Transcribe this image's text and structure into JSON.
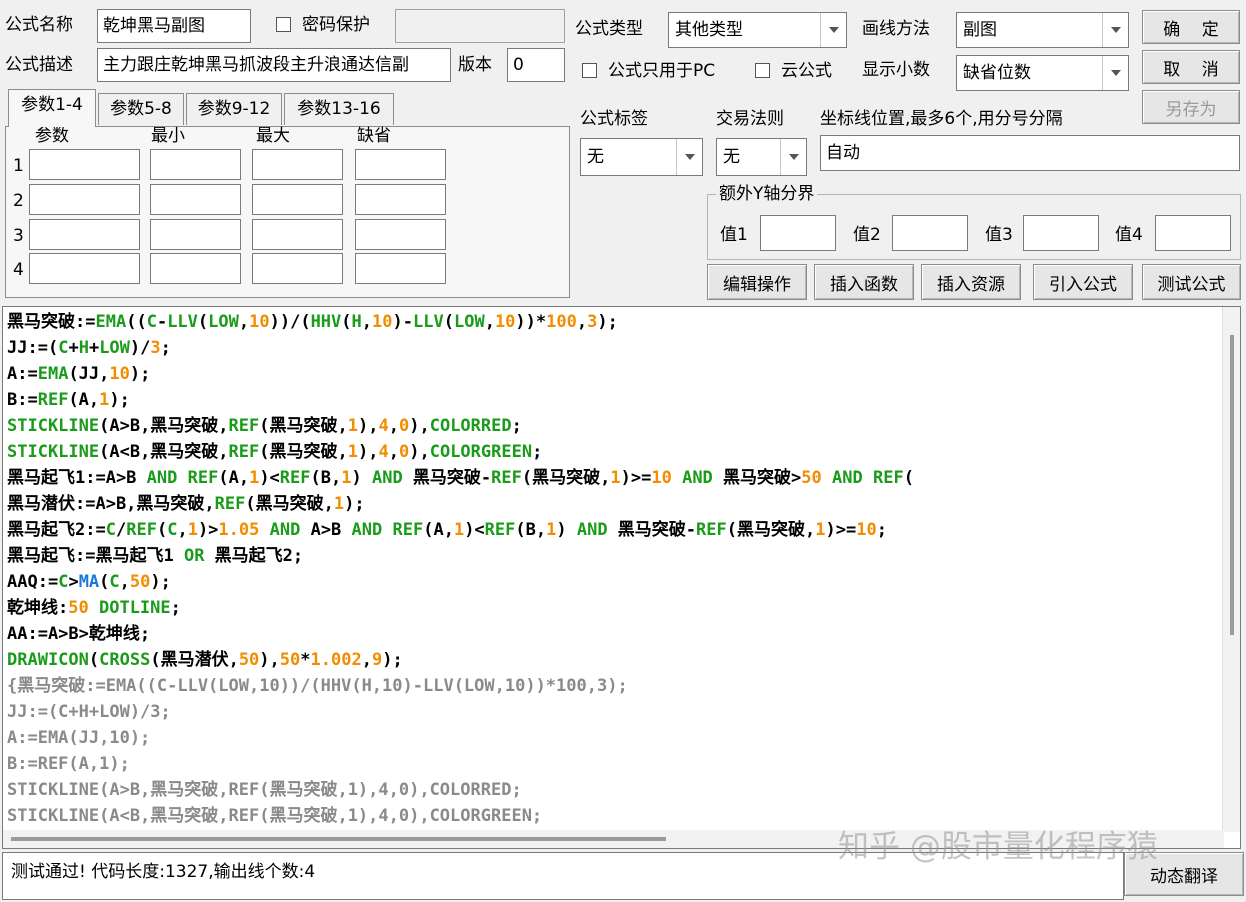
{
  "top": {
    "formula_name_label": "公式名称",
    "formula_name_value": "乾坤黑马副图",
    "password_label": "密码保护",
    "password_value": "",
    "formula_desc_label": "公式描述",
    "formula_desc_value": "主力跟庄乾坤黑马抓波段主升浪通达信副",
    "version_label": "版本",
    "version_value": "0",
    "formula_type_label": "公式类型",
    "formula_type_value": "其他类型",
    "draw_method_label": "画线方法",
    "draw_method_value": "副图",
    "pc_only_label": "公式只用于PC",
    "cloud_label": "云公式",
    "decimals_label": "显示小数",
    "decimals_value": "缺省位数"
  },
  "buttons": {
    "ok": "确 定",
    "cancel": "取 消",
    "save_as": "另存为",
    "edit_ops": "编辑操作",
    "insert_func": "插入函数",
    "insert_res": "插入资源",
    "import_formula": "引入公式",
    "test_formula": "测试公式",
    "dynamic_translate": "动态翻译"
  },
  "params": {
    "tabs": [
      "参数1-4",
      "参数5-8",
      "参数9-12",
      "参数13-16"
    ],
    "headers": [
      "参数",
      "最小",
      "最大",
      "缺省"
    ],
    "rows": [
      "1",
      "2",
      "3",
      "4"
    ]
  },
  "tag": {
    "label": "公式标签",
    "value": "无",
    "trade_label": "交易法则",
    "trade_value": "无",
    "axis_label": "坐标线位置,最多6个,用分号分隔",
    "axis_value": "自动"
  },
  "yaxis": {
    "group_label": "额外Y轴分界",
    "v1": "值1",
    "v2": "值2",
    "v3": "值3",
    "v4": "值4"
  },
  "code": [
    [
      [
        "",
        "黑马突破:="
      ],
      [
        "fn",
        "EMA"
      ],
      [
        "",
        "(("
      ],
      [
        "fn",
        "C"
      ],
      [
        "",
        "-"
      ],
      [
        "fn",
        "LLV"
      ],
      [
        "",
        "("
      ],
      [
        "fn",
        "LOW"
      ],
      [
        "",
        ","
      ],
      [
        "num",
        "10"
      ],
      [
        "",
        "))/("
      ],
      [
        "fn",
        "HHV"
      ],
      [
        "",
        "("
      ],
      [
        "fn",
        "H"
      ],
      [
        "",
        ","
      ],
      [
        "num",
        "10"
      ],
      [
        "",
        ")-"
      ],
      [
        "fn",
        "LLV"
      ],
      [
        "",
        "("
      ],
      [
        "fn",
        "LOW"
      ],
      [
        "",
        ","
      ],
      [
        "num",
        "10"
      ],
      [
        "",
        "))*"
      ],
      [
        "num",
        "100"
      ],
      [
        "",
        ","
      ],
      [
        "num",
        "3"
      ],
      [
        "",
        ");"
      ]
    ],
    [
      [
        "",
        "JJ:=("
      ],
      [
        "fn",
        "C"
      ],
      [
        "",
        "+"
      ],
      [
        "fn",
        "H"
      ],
      [
        "",
        "+"
      ],
      [
        "fn",
        "LOW"
      ],
      [
        "",
        ")/"
      ],
      [
        "num",
        "3"
      ],
      [
        "",
        ";"
      ]
    ],
    [
      [
        "",
        "A:="
      ],
      [
        "fn",
        "EMA"
      ],
      [
        "",
        "(JJ,"
      ],
      [
        "num",
        "10"
      ],
      [
        "",
        ");"
      ]
    ],
    [
      [
        "",
        "B:="
      ],
      [
        "fn",
        "REF"
      ],
      [
        "",
        "(A,"
      ],
      [
        "num",
        "1"
      ],
      [
        "",
        ");"
      ]
    ],
    [
      [
        "fn",
        "STICKLINE"
      ],
      [
        "",
        "(A>B,黑马突破,"
      ],
      [
        "fn",
        "REF"
      ],
      [
        "",
        "(黑马突破,"
      ],
      [
        "num",
        "1"
      ],
      [
        "",
        "),"
      ],
      [
        "num",
        "4"
      ],
      [
        "",
        ","
      ],
      [
        "num",
        "0"
      ],
      [
        "",
        "),"
      ],
      [
        "fn",
        "COLORRED"
      ],
      [
        "",
        ";"
      ]
    ],
    [
      [
        "fn",
        "STICKLINE"
      ],
      [
        "",
        "(A<B,黑马突破,"
      ],
      [
        "fn",
        "REF"
      ],
      [
        "",
        "(黑马突破,"
      ],
      [
        "num",
        "1"
      ],
      [
        "",
        "),"
      ],
      [
        "num",
        "4"
      ],
      [
        "",
        ","
      ],
      [
        "num",
        "0"
      ],
      [
        "",
        "),"
      ],
      [
        "fn",
        "COLORGREEN"
      ],
      [
        "",
        ";"
      ]
    ],
    [
      [
        "",
        "黑马起飞1:=A>B "
      ],
      [
        "kw",
        "AND"
      ],
      [
        "",
        " "
      ],
      [
        "fn",
        "REF"
      ],
      [
        "",
        "(A,"
      ],
      [
        "num",
        "1"
      ],
      [
        "",
        ")<"
      ],
      [
        "fn",
        "REF"
      ],
      [
        "",
        "(B,"
      ],
      [
        "num",
        "1"
      ],
      [
        "",
        ") "
      ],
      [
        "kw",
        "AND"
      ],
      [
        "",
        " 黑马突破-"
      ],
      [
        "fn",
        "REF"
      ],
      [
        "",
        "(黑马突破,"
      ],
      [
        "num",
        "1"
      ],
      [
        "",
        ")>="
      ],
      [
        "num",
        "10"
      ],
      [
        "",
        " "
      ],
      [
        "kw",
        "AND"
      ],
      [
        "",
        " 黑马突破>"
      ],
      [
        "num",
        "50"
      ],
      [
        "",
        " "
      ],
      [
        "kw",
        "AND"
      ],
      [
        "",
        " "
      ],
      [
        "fn",
        "REF"
      ],
      [
        "",
        "("
      ]
    ],
    [
      [
        "",
        "黑马潜伏:=A>B,黑马突破,"
      ],
      [
        "fn",
        "REF"
      ],
      [
        "",
        "(黑马突破,"
      ],
      [
        "num",
        "1"
      ],
      [
        "",
        ");"
      ]
    ],
    [
      [
        "",
        "黑马起飞2:="
      ],
      [
        "fn",
        "C"
      ],
      [
        "",
        "/"
      ],
      [
        "fn",
        "REF"
      ],
      [
        "",
        "("
      ],
      [
        "fn",
        "C"
      ],
      [
        "",
        ","
      ],
      [
        "num",
        "1"
      ],
      [
        "",
        ")>"
      ],
      [
        "num",
        "1.05"
      ],
      [
        "",
        " "
      ],
      [
        "kw",
        "AND"
      ],
      [
        "",
        " A>B "
      ],
      [
        "kw",
        "AND"
      ],
      [
        "",
        " "
      ],
      [
        "fn",
        "REF"
      ],
      [
        "",
        "(A,"
      ],
      [
        "num",
        "1"
      ],
      [
        "",
        ")<"
      ],
      [
        "fn",
        "REF"
      ],
      [
        "",
        "(B,"
      ],
      [
        "num",
        "1"
      ],
      [
        "",
        ") "
      ],
      [
        "kw",
        "AND"
      ],
      [
        "",
        " 黑马突破-"
      ],
      [
        "fn",
        "REF"
      ],
      [
        "",
        "(黑马突破,"
      ],
      [
        "num",
        "1"
      ],
      [
        "",
        ")>="
      ],
      [
        "num",
        "10"
      ],
      [
        "",
        ";"
      ]
    ],
    [
      [
        "",
        "黑马起飞:=黑马起飞1 "
      ],
      [
        "kw",
        "OR"
      ],
      [
        "",
        " 黑马起飞2;"
      ]
    ],
    [
      [
        "",
        "AAQ:="
      ],
      [
        "fn",
        "C"
      ],
      [
        "",
        ">"
      ],
      [
        "ma",
        "MA"
      ],
      [
        "",
        "("
      ],
      [
        "fn",
        "C"
      ],
      [
        "",
        ","
      ],
      [
        "num",
        "50"
      ],
      [
        "",
        ");"
      ]
    ],
    [
      [
        "",
        "乾坤线:"
      ],
      [
        "num",
        "50"
      ],
      [
        "",
        " "
      ],
      [
        "fn",
        "DOTLINE"
      ],
      [
        "",
        ";"
      ]
    ],
    [
      [
        "",
        "AA:=A>B>乾坤线;"
      ]
    ],
    [
      [
        "fn",
        "DRAWICON"
      ],
      [
        "",
        "("
      ],
      [
        "fn",
        "CROSS"
      ],
      [
        "",
        "(黑马潜伏,"
      ],
      [
        "num",
        "50"
      ],
      [
        "",
        "),"
      ],
      [
        "num",
        "50"
      ],
      [
        "",
        "*"
      ],
      [
        "num",
        "1.002"
      ],
      [
        "",
        ","
      ],
      [
        "num",
        "9"
      ],
      [
        "",
        ");"
      ]
    ],
    [
      [
        "cmt",
        "{黑马突破:=EMA((C-LLV(LOW,10))/(HHV(H,10)-LLV(LOW,10))*100,3);"
      ]
    ],
    [
      [
        "cmt",
        "JJ:=(C+H+LOW)/3;"
      ]
    ],
    [
      [
        "cmt",
        "A:=EMA(JJ,10);"
      ]
    ],
    [
      [
        "cmt",
        "B:=REF(A,1);"
      ]
    ],
    [
      [
        "cmt",
        "STICKLINE(A>B,黑马突破,REF(黑马突破,1),4,0),COLORRED;"
      ]
    ],
    [
      [
        "cmt",
        "STICKLINE(A<B,黑马突破,REF(黑马突破,1),4,0),COLORGREEN;"
      ]
    ]
  ],
  "status": "测试通过! 代码长度:1327,输出线个数:4",
  "watermark": "知乎 @股市量化程序猿",
  "colors": {
    "function": "#1a9b1a",
    "number": "#f28c00",
    "ma": "#1a7ad6",
    "comment": "#8a8a8a"
  }
}
